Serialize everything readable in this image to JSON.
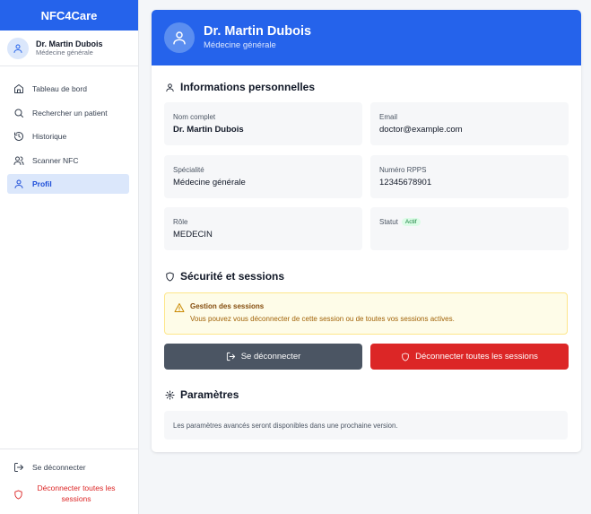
{
  "app": {
    "brand": "NFC4Care"
  },
  "sidebar": {
    "user": {
      "name": "Dr. Martin Dubois",
      "role": "Médecine générale"
    },
    "items": [
      {
        "label": "Tableau de bord",
        "icon": "home-icon"
      },
      {
        "label": "Rechercher un patient",
        "icon": "search-icon"
      },
      {
        "label": "Historique",
        "icon": "history-icon"
      },
      {
        "label": "Scanner NFC",
        "icon": "users-icon"
      },
      {
        "label": "Profil",
        "icon": "user-icon",
        "active": true
      }
    ],
    "logout_label": "Se déconnecter",
    "logout_all_label": "Déconnecter toutes les sessions"
  },
  "profile": {
    "header": {
      "name": "Dr. Martin Dubois",
      "role": "Médecine générale"
    },
    "personal_title": "Informations personnelles",
    "fields": {
      "fullname": {
        "label": "Nom complet",
        "value": "Dr. Martin Dubois"
      },
      "email": {
        "label": "Email",
        "value": "doctor@example.com"
      },
      "specialty": {
        "label": "Spécialité",
        "value": "Médecine générale"
      },
      "rpps": {
        "label": "Numéro RPPS",
        "value": "12345678901"
      },
      "role": {
        "label": "Rôle",
        "value": "MEDECIN"
      },
      "status": {
        "label": "Statut",
        "badge": "Actif"
      }
    },
    "security_title": "Sécurité et sessions",
    "warning": {
      "title": "Gestion des sessions",
      "text": "Vous pouvez vous déconnecter de cette session ou de toutes vos sessions actives."
    },
    "logout_button": "Se déconnecter",
    "logout_all_button": "Déconnecter toutes les sessions",
    "settings_title": "Paramètres",
    "settings_text": "Les paramètres avancés seront disponibles dans une prochaine version."
  },
  "colors": {
    "primary": "#2563eb",
    "danger": "#dc2626",
    "active_bg": "#dbe7fb",
    "success": "#15803d"
  }
}
